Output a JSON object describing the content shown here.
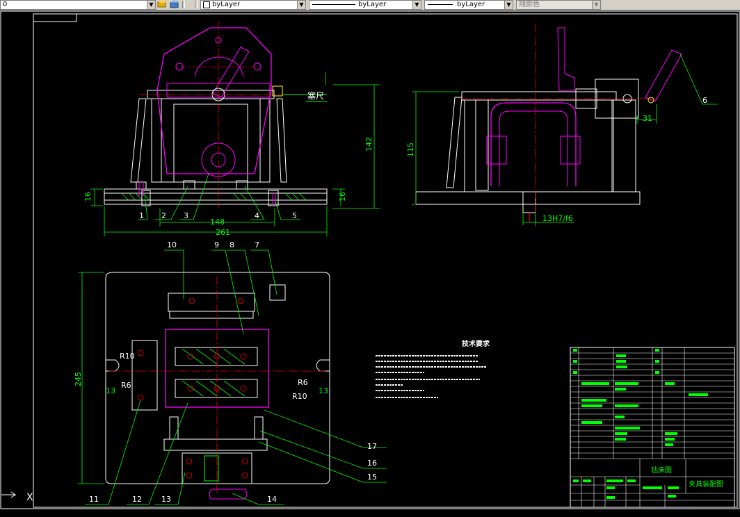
{
  "toolbar": {
    "layer_value": "0",
    "color_value": "byLayer",
    "linetype_value": "byLayer",
    "lineweight_value": "byLayer",
    "plotstyle_value": "随颜色"
  },
  "drawing": {
    "front_view_label": "塞尺",
    "dims": {
      "d16_left": "16",
      "d16_right": "16",
      "d142": "142",
      "d148": "148",
      "d261": "261",
      "d115": "115",
      "d31": "31",
      "d13h7": "13H7/f6",
      "d245": "245",
      "r10_left": "R10",
      "r6_left": "R6",
      "d13_left": "13",
      "r6_right": "R6",
      "r10_right": "R10",
      "d13_right": "13"
    },
    "balloons": [
      "1",
      "2",
      "3",
      "4",
      "5",
      "6",
      "7",
      "8",
      "9",
      "10",
      "11",
      "12",
      "13",
      "14",
      "15",
      "16",
      "17"
    ],
    "tech_req_title": "技术要求",
    "title_block": {
      "part_title": "夹具装配图",
      "drawing_name": "钻床图"
    }
  },
  "colors": {
    "background": "#000000",
    "outline": "#ffffff",
    "part": "#ff00ff",
    "dimension": "#00ff00",
    "centerline": "#ff0000",
    "hatch": "#ffff00",
    "highlight": "#00ffff"
  },
  "statusbar": {
    "ucs_icon_label": "X"
  }
}
